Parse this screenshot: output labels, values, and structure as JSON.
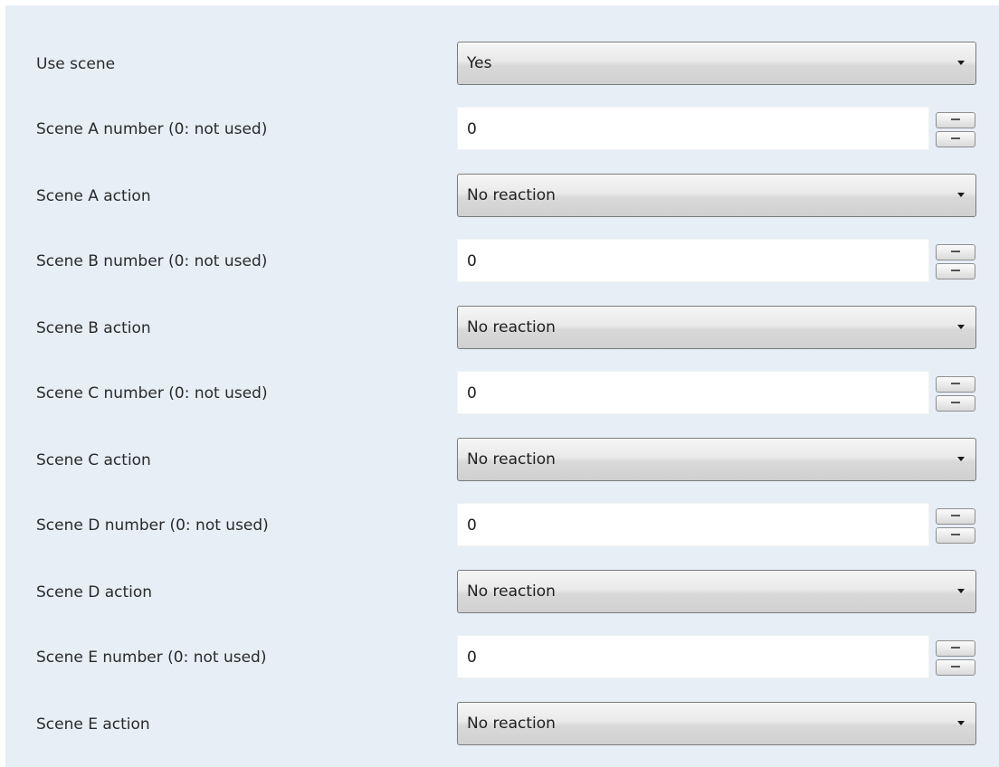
{
  "rows": [
    {
      "label": "Use scene",
      "value": "Yes"
    },
    {
      "label": "Scene A number (0: not used)",
      "value": "0"
    },
    {
      "label": "Scene A action",
      "value": "No reaction"
    },
    {
      "label": "Scene B number (0: not used)",
      "value": "0"
    },
    {
      "label": "Scene B action",
      "value": "No reaction"
    },
    {
      "label": "Scene C number (0: not used)",
      "value": "0"
    },
    {
      "label": "Scene C action",
      "value": "No reaction"
    },
    {
      "label": "Scene D number (0: not used)",
      "value": "0"
    },
    {
      "label": "Scene D action",
      "value": "No reaction"
    },
    {
      "label": "Scene E number (0: not used)",
      "value": "0"
    },
    {
      "label": "Scene E action",
      "value": "No reaction"
    }
  ],
  "icons": {
    "dropdown": "chevron-down-icon",
    "spinner_up": "increment-icon",
    "spinner_down": "decrement-icon"
  }
}
